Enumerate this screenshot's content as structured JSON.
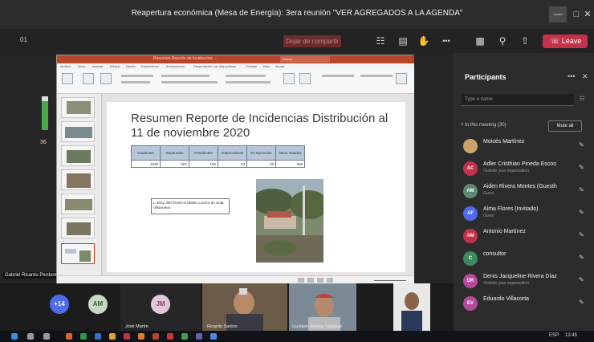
{
  "window": {
    "title": "Reapertura económica (Mesa de Energía): 3era reunión \"VER AGREGADOS A LA AGENDA\"",
    "minimize": "—",
    "maximize": "□",
    "close": "✕"
  },
  "toolbar": {
    "timer": "01",
    "stop_share": "Dejar de compartir",
    "leave": "Leave",
    "more": "•••"
  },
  "share": {
    "page_number": "36",
    "presenter": "Gabriel Ricardo Perdomo Zelaya"
  },
  "ppt": {
    "title_text": "Resumen Reporte de Incidencias ...",
    "search": "Buscar",
    "tabs": [
      "Archivo",
      "Inicio",
      "Insertar",
      "Dibujar",
      "Diseño",
      "Transiciones",
      "Animaciones",
      "Presentación con diapositivas",
      "Revisar",
      "Vista",
      "Ayuda"
    ],
    "slide": {
      "title": "Resumen Reporte de Incidencias Distribución al 11 de noviembre 2020",
      "table_headers": [
        "Incidentes",
        "Reparados",
        "Pendientes",
        "Improcedente",
        "En Ejecución",
        "Otros estados"
      ],
      "table_values": [
        "1030",
        "507",
        "192",
        "33",
        "29",
        "306"
      ],
      "note": "L.2821.300 frente al Matter Lucero de Sula. Villanueva"
    }
  },
  "panel": {
    "title": "Participants",
    "more": "•••",
    "close": "✕",
    "type_placeholder": "Type a name",
    "in_meeting": "In this meeting (30)",
    "mute_all": "Mute all",
    "people": [
      {
        "initials": "",
        "name": "Moisés Martínez",
        "sub": "",
        "color": "#c9a26b"
      },
      {
        "initials": "AC",
        "name": "Adler Cristhian Pineda Escoo",
        "sub": "Outside your organization",
        "color": "#c4314b"
      },
      {
        "initials": "AM",
        "name": "Aiden Rivera Montes (Guesth",
        "sub": "Guest",
        "color": "#5b8a72"
      },
      {
        "initials": "AF",
        "name": "Alma Flores (Invitado)",
        "sub": "Guest",
        "color": "#4f6bed"
      },
      {
        "initials": "AM",
        "name": "Antonio Martínez",
        "sub": "",
        "color": "#c4314b"
      },
      {
        "initials": "C",
        "name": "consultor",
        "sub": "",
        "color": "#3c8a5c"
      },
      {
        "initials": "DR",
        "name": "Denis Jacqueline Rivera Díaz",
        "sub": "Outside your organization",
        "color": "#b44a9b"
      },
      {
        "initials": "EV",
        "name": "Eduardo Villacorta",
        "sub": "",
        "color": "#b44a9b"
      }
    ]
  },
  "strip": {
    "overflow_count": "+14",
    "av1": "AM",
    "av2": "JM",
    "label_jm": "José Martín",
    "label_v1": "Ricardo Santos",
    "label_v2": "Gustavo Ramos Vásquez"
  },
  "taskbar": {
    "lang": "ESP",
    "time": "13:45"
  },
  "colors": {
    "leave": "#c4314b",
    "ppt_accent": "#b7472a",
    "panel_bg": "#2d2c2c"
  }
}
